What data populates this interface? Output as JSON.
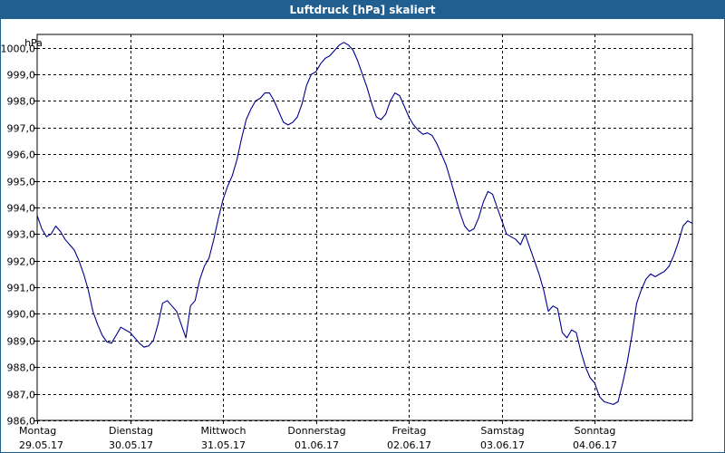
{
  "window": {
    "title": "Luftdruck [hPa] skaliert"
  },
  "colors": {
    "titlebar": "#215f91",
    "series": "#00008b",
    "grid": "#000000"
  },
  "chart_data": {
    "type": "line",
    "title": "Luftdruck [hPa] skaliert",
    "ylabel": "hPa",
    "ylim": [
      986.0,
      1000.5
    ],
    "grid": true,
    "x_ticks": [
      {
        "line1": "Montag",
        "line2": "29.05.17"
      },
      {
        "line1": "Dienstag",
        "line2": "30.05.17"
      },
      {
        "line1": "Mittwoch",
        "line2": "31.05.17"
      },
      {
        "line1": "Donnerstag",
        "line2": "01.06.17"
      },
      {
        "line1": "Freitag",
        "line2": "02.06.17"
      },
      {
        "line1": "Samstag",
        "line2": "03.06.17"
      },
      {
        "line1": "Sonntag",
        "line2": "04.06.17"
      }
    ],
    "y_ticks": [
      "986,0",
      "987,0",
      "988,0",
      "989,0",
      "990,0",
      "991,0",
      "992,0",
      "993,0",
      "994,0",
      "995,0",
      "996,0",
      "997,0",
      "998,0",
      "999,0",
      "1000,0"
    ],
    "series": [
      {
        "points": [
          [
            0.0,
            993.7
          ],
          [
            0.05,
            993.2
          ],
          [
            0.1,
            992.9
          ],
          [
            0.15,
            993.0
          ],
          [
            0.2,
            993.3
          ],
          [
            0.25,
            993.1
          ],
          [
            0.3,
            992.8
          ],
          [
            0.35,
            992.6
          ],
          [
            0.4,
            992.4
          ],
          [
            0.45,
            992.0
          ],
          [
            0.5,
            991.5
          ],
          [
            0.55,
            990.9
          ],
          [
            0.6,
            990.1
          ],
          [
            0.65,
            989.6
          ],
          [
            0.7,
            989.2
          ],
          [
            0.75,
            988.95
          ],
          [
            0.8,
            988.9
          ],
          [
            0.85,
            989.2
          ],
          [
            0.9,
            989.5
          ],
          [
            0.95,
            989.4
          ],
          [
            1.0,
            989.3
          ],
          [
            1.05,
            989.1
          ],
          [
            1.1,
            988.9
          ],
          [
            1.15,
            988.75
          ],
          [
            1.2,
            988.8
          ],
          [
            1.25,
            989.0
          ],
          [
            1.3,
            989.6
          ],
          [
            1.35,
            990.4
          ],
          [
            1.4,
            990.5
          ],
          [
            1.45,
            990.3
          ],
          [
            1.5,
            990.1
          ],
          [
            1.55,
            989.6
          ],
          [
            1.6,
            989.1
          ],
          [
            1.65,
            990.3
          ],
          [
            1.7,
            990.5
          ],
          [
            1.75,
            991.3
          ],
          [
            1.8,
            991.8
          ],
          [
            1.85,
            992.1
          ],
          [
            1.9,
            992.8
          ],
          [
            1.95,
            993.6
          ],
          [
            2.0,
            994.3
          ],
          [
            2.05,
            994.8
          ],
          [
            2.1,
            995.2
          ],
          [
            2.15,
            995.8
          ],
          [
            2.2,
            996.6
          ],
          [
            2.25,
            997.3
          ],
          [
            2.3,
            997.7
          ],
          [
            2.35,
            998.0
          ],
          [
            2.4,
            998.1
          ],
          [
            2.45,
            998.3
          ],
          [
            2.5,
            998.3
          ],
          [
            2.55,
            998.0
          ],
          [
            2.6,
            997.6
          ],
          [
            2.65,
            997.2
          ],
          [
            2.7,
            997.1
          ],
          [
            2.75,
            997.2
          ],
          [
            2.8,
            997.4
          ],
          [
            2.85,
            997.9
          ],
          [
            2.9,
            998.6
          ],
          [
            2.95,
            999.0
          ],
          [
            3.0,
            999.1
          ],
          [
            3.05,
            999.4
          ],
          [
            3.1,
            999.6
          ],
          [
            3.15,
            999.7
          ],
          [
            3.2,
            999.9
          ],
          [
            3.25,
            1000.1
          ],
          [
            3.3,
            1000.2
          ],
          [
            3.35,
            1000.1
          ],
          [
            3.4,
            999.9
          ],
          [
            3.45,
            999.5
          ],
          [
            3.5,
            999.0
          ],
          [
            3.55,
            998.5
          ],
          [
            3.6,
            997.9
          ],
          [
            3.65,
            997.4
          ],
          [
            3.7,
            997.3
          ],
          [
            3.75,
            997.5
          ],
          [
            3.8,
            998.0
          ],
          [
            3.85,
            998.3
          ],
          [
            3.9,
            998.2
          ],
          [
            3.95,
            997.8
          ],
          [
            4.0,
            997.4
          ],
          [
            4.05,
            997.1
          ],
          [
            4.1,
            996.9
          ],
          [
            4.15,
            996.75
          ],
          [
            4.2,
            996.8
          ],
          [
            4.25,
            996.7
          ],
          [
            4.3,
            996.4
          ],
          [
            4.35,
            996.0
          ],
          [
            4.4,
            995.6
          ],
          [
            4.45,
            995.0
          ],
          [
            4.5,
            994.4
          ],
          [
            4.55,
            993.8
          ],
          [
            4.6,
            993.3
          ],
          [
            4.65,
            993.1
          ],
          [
            4.7,
            993.2
          ],
          [
            4.75,
            993.6
          ],
          [
            4.8,
            994.2
          ],
          [
            4.85,
            994.6
          ],
          [
            4.9,
            994.5
          ],
          [
            4.95,
            994.0
          ],
          [
            5.0,
            993.5
          ],
          [
            5.05,
            993.0
          ],
          [
            5.1,
            992.9
          ],
          [
            5.15,
            992.8
          ],
          [
            5.2,
            992.6
          ],
          [
            5.25,
            993.0
          ],
          [
            5.3,
            992.5
          ],
          [
            5.35,
            992.0
          ],
          [
            5.4,
            991.5
          ],
          [
            5.45,
            990.9
          ],
          [
            5.5,
            990.1
          ],
          [
            5.55,
            990.3
          ],
          [
            5.6,
            990.2
          ],
          [
            5.65,
            989.3
          ],
          [
            5.7,
            989.1
          ],
          [
            5.75,
            989.4
          ],
          [
            5.8,
            989.3
          ],
          [
            5.85,
            988.6
          ],
          [
            5.9,
            988.0
          ],
          [
            5.95,
            987.6
          ],
          [
            6.0,
            987.4
          ],
          [
            6.05,
            986.9
          ],
          [
            6.1,
            986.7
          ],
          [
            6.15,
            986.65
          ],
          [
            6.2,
            986.6
          ],
          [
            6.25,
            986.7
          ],
          [
            6.3,
            987.4
          ],
          [
            6.35,
            988.2
          ],
          [
            6.4,
            989.2
          ],
          [
            6.45,
            990.4
          ],
          [
            6.5,
            990.9
          ],
          [
            6.55,
            991.3
          ],
          [
            6.6,
            991.5
          ],
          [
            6.65,
            991.4
          ],
          [
            6.7,
            991.5
          ],
          [
            6.75,
            991.6
          ],
          [
            6.8,
            991.8
          ],
          [
            6.85,
            992.2
          ],
          [
            6.9,
            992.7
          ],
          [
            6.95,
            993.3
          ],
          [
            7.0,
            993.5
          ],
          [
            7.05,
            993.4
          ]
        ]
      }
    ]
  }
}
